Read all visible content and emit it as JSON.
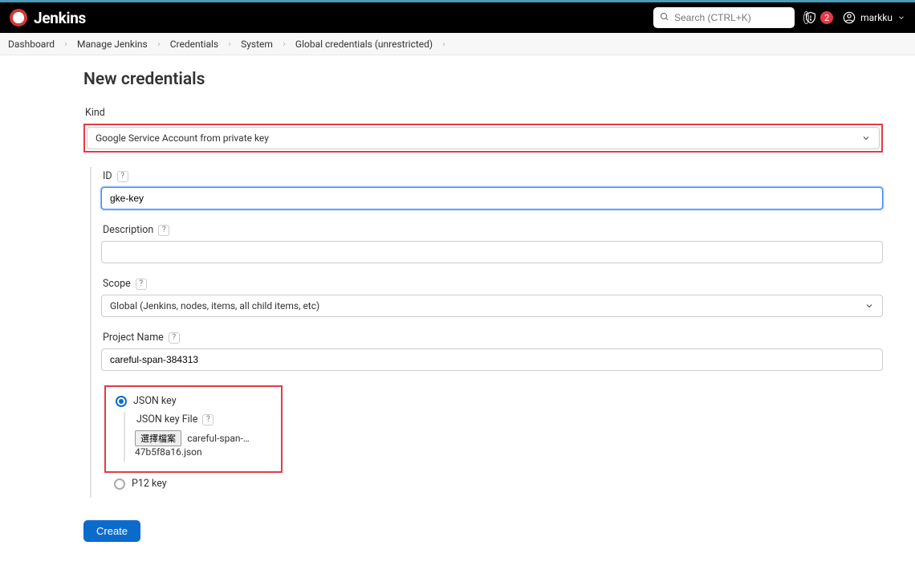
{
  "topbar": {
    "product": "Jenkins",
    "search_placeholder": "Search (CTRL+K)",
    "alert_count": "2",
    "username": "markku"
  },
  "breadcrumbs": {
    "items": [
      "Dashboard",
      "Manage Jenkins",
      "Credentials",
      "System",
      "Global credentials (unrestricted)"
    ]
  },
  "page": {
    "title": "New credentials"
  },
  "form": {
    "kind": {
      "label": "Kind",
      "value": "Google Service Account from private key"
    },
    "id": {
      "label": "ID",
      "value": "gke-key"
    },
    "description": {
      "label": "Description",
      "value": ""
    },
    "scope": {
      "label": "Scope",
      "value": "Global (Jenkins, nodes, items, all child items, etc)"
    },
    "project_name": {
      "label": "Project Name",
      "value": "careful-span-384313"
    },
    "keys": {
      "json": {
        "label": "JSON key",
        "file_label": "JSON key File",
        "choose_btn": "選擇檔案",
        "file_name": "careful-span-…47b5f8a16.json",
        "selected": true
      },
      "p12": {
        "label": "P12 key",
        "selected": false
      }
    },
    "create": "Create"
  }
}
